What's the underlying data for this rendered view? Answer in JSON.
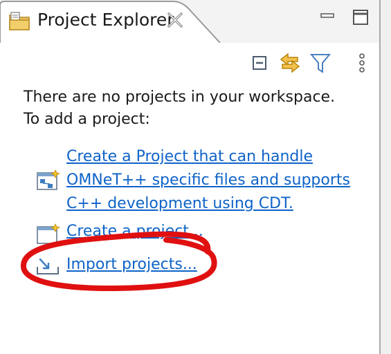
{
  "tab": {
    "title": "Project Explorer",
    "icon": "project-explorer-icon",
    "close_icon": "close-icon"
  },
  "window_buttons": [
    "minimize-icon",
    "maximize-icon"
  ],
  "toolbar": [
    "collapse-all-icon",
    "link-with-editor-icon",
    "filter-icon",
    "view-menu-icon"
  ],
  "message": {
    "line1": "There are no projects in your workspace.",
    "line2": "To add a project:"
  },
  "actions": {
    "omnet": {
      "line1": "Create a Project that can handle ",
      "line2": "OMNeT++ specific files and supports ",
      "line3": "C++ development using CDT."
    },
    "create": {
      "label": "Create a project..."
    },
    "import": {
      "label": "Import projects..."
    }
  },
  "colors": {
    "link": "#0e63c8",
    "annotation": "#e01010"
  }
}
